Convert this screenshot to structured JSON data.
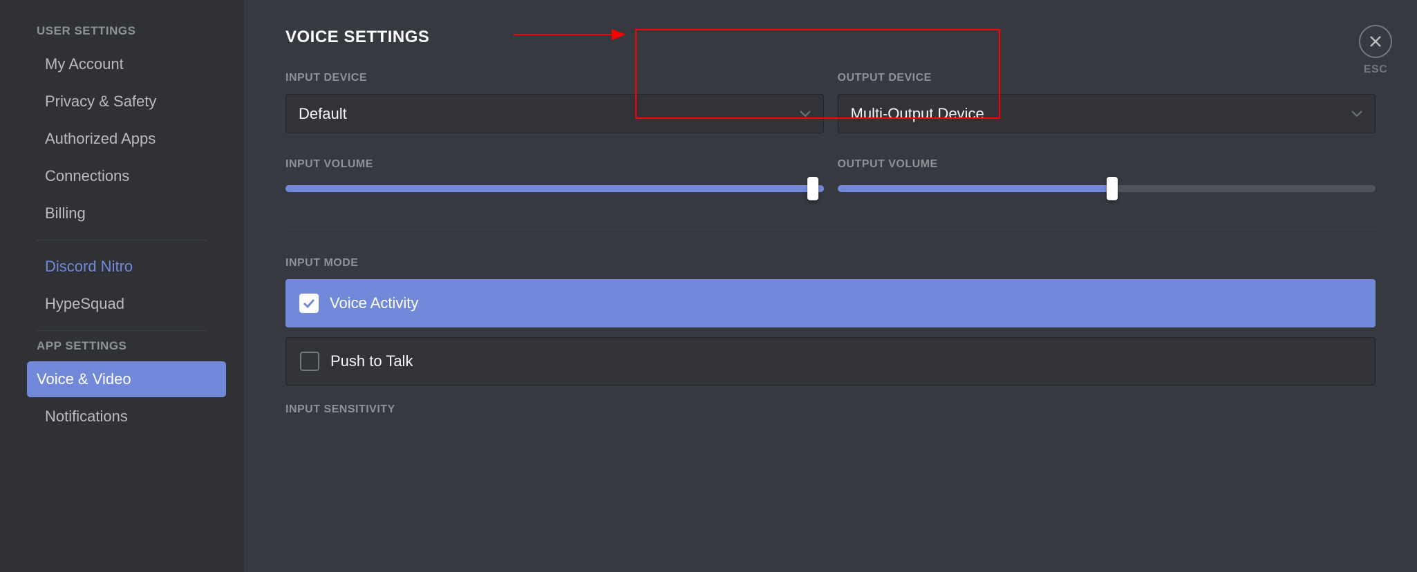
{
  "sidebar": {
    "user_settings_header": "USER SETTINGS",
    "app_settings_header": "APP SETTINGS",
    "items": [
      {
        "label": "My Account"
      },
      {
        "label": "Privacy & Safety"
      },
      {
        "label": "Authorized Apps"
      },
      {
        "label": "Connections"
      },
      {
        "label": "Billing"
      }
    ],
    "nitro_items": [
      {
        "label": "Discord Nitro"
      },
      {
        "label": "HypeSquad"
      }
    ],
    "app_items": [
      {
        "label": "Voice & Video"
      },
      {
        "label": "Notifications"
      }
    ]
  },
  "page": {
    "title": "VOICE SETTINGS",
    "input_device_label": "INPUT DEVICE",
    "input_device_value": "Default",
    "output_device_label": "OUTPUT DEVICE",
    "output_device_value": "Multi-Output Device",
    "input_volume_label": "INPUT VOLUME",
    "output_volume_label": "OUTPUT VOLUME",
    "input_volume_percent": 100,
    "output_volume_percent": 50,
    "input_mode_label": "INPUT MODE",
    "input_modes": [
      {
        "label": "Voice Activity",
        "selected": true
      },
      {
        "label": "Push to Talk",
        "selected": false
      }
    ],
    "input_sensitivity_label": "INPUT SENSITIVITY",
    "close_label": "ESC"
  },
  "colors": {
    "accent": "#7289da",
    "highlight": "#ff0000"
  }
}
